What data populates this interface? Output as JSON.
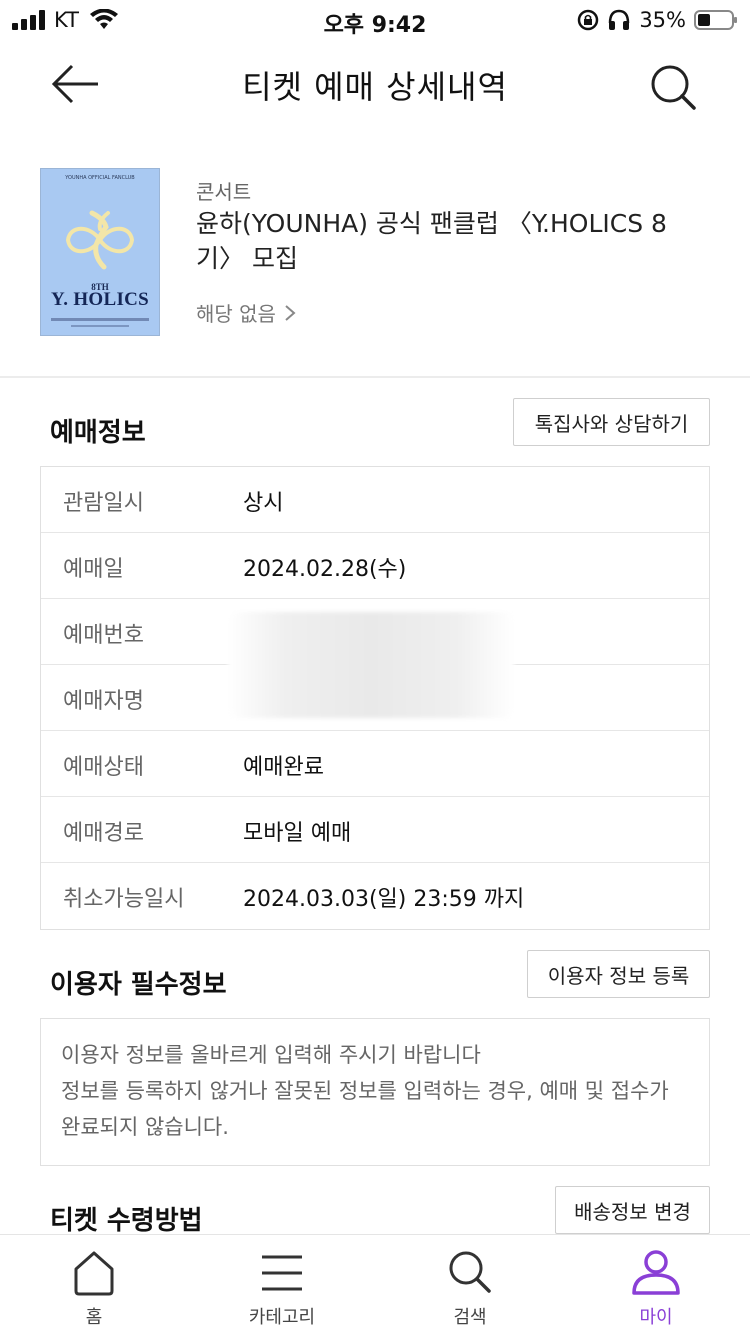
{
  "status_bar": {
    "carrier": "KT",
    "time": "오후 9:42",
    "battery": "35%"
  },
  "header": {
    "title": "티켓 예매 상세내역",
    "back_icon": "arrow-left-icon",
    "search_icon": "search-icon"
  },
  "product": {
    "poster": {
      "top_text": "YOUNHA OFFICIAL FANCLUB",
      "sub_text": "8TH",
      "main_text": "Y. HOLICS"
    },
    "category": "콘서트",
    "title": "윤하(YOUNHA) 공식 팬클럽 〈Y.HOLICS 8기〉 모집",
    "venue": "해당 없음"
  },
  "booking_info": {
    "section_title": "예매정보",
    "consult_button": "톡집사와 상담하기",
    "rows": [
      {
        "label": "관람일시",
        "value": "상시"
      },
      {
        "label": "예매일",
        "value": "2024.02.28(수)"
      },
      {
        "label": "예매번호",
        "value": ""
      },
      {
        "label": "예매자명",
        "value": ""
      },
      {
        "label": "예매상태",
        "value": "예매완료"
      },
      {
        "label": "예매경로",
        "value": "모바일 예매"
      },
      {
        "label": "취소가능일시",
        "value": "2024.03.03(일) 23:59 까지"
      }
    ]
  },
  "user_info": {
    "section_title": "이용자 필수정보",
    "register_button": "이용자 정보 등록",
    "notice_line1": "이용자 정보를 올바르게 입력해 주시기 바랍니다",
    "notice_line2": "정보를 등록하지 않거나 잘못된 정보를 입력하는 경우, 예매 및 접수가 완료되지 않습니다."
  },
  "ticket_receive": {
    "section_title": "티켓 수령방법",
    "change_button": "배송정보 변경"
  },
  "tab_bar": {
    "items": [
      {
        "label": "홈",
        "icon": "home-icon"
      },
      {
        "label": "카테고리",
        "icon": "menu-icon"
      },
      {
        "label": "검색",
        "icon": "search-icon"
      },
      {
        "label": "마이",
        "icon": "person-icon"
      }
    ],
    "active_color": "#8a3fd6"
  }
}
